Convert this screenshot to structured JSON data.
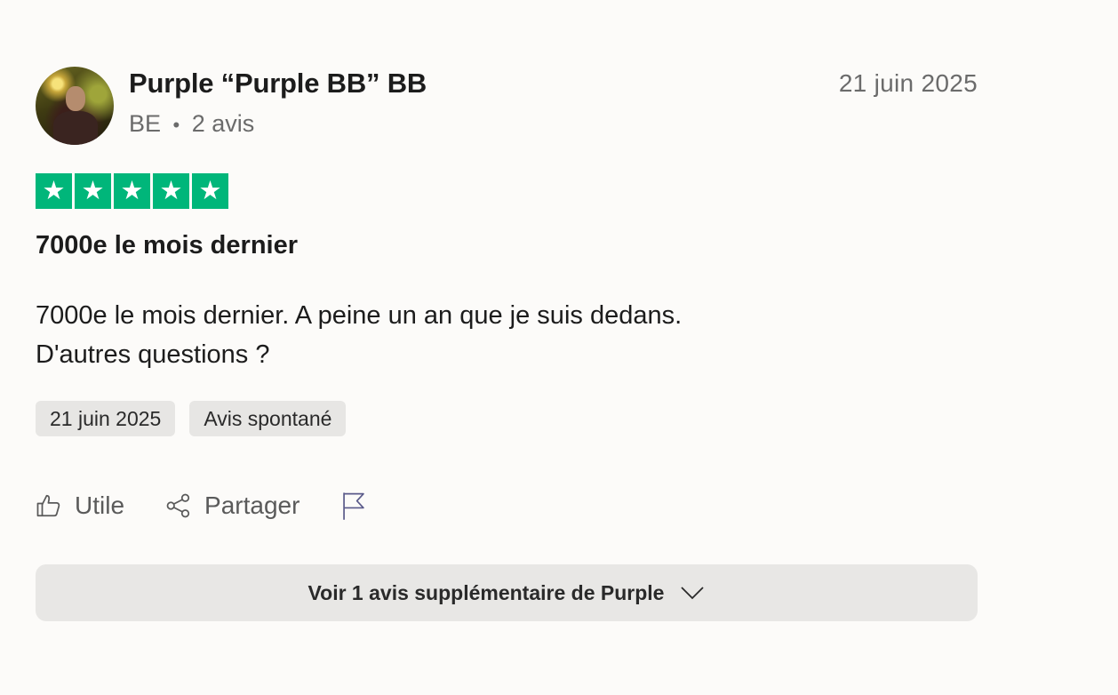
{
  "reviewer": {
    "name": "Purple “Purple BB” BB",
    "country": "BE",
    "separator": "•",
    "review_count": "2 avis"
  },
  "review": {
    "date": "21 juin 2025",
    "rating": 5,
    "title": "7000e le mois dernier",
    "body_line1": "7000e le mois dernier. A peine un an que je suis dedans.",
    "body_line2": "D'autres questions ?",
    "tags": [
      "21 juin 2025",
      "Avis spontané"
    ]
  },
  "actions": {
    "useful": "Utile",
    "share": "Partager"
  },
  "more_button": "Voir 1 avis supplémentaire de Purple",
  "icons": {
    "star": "★",
    "thumbs_up": "thumbs-up-icon",
    "share": "share-icon",
    "flag": "flag-icon",
    "chevron": "chevron-down-icon"
  },
  "colors": {
    "star_green": "#00b67a",
    "background": "#fcfbf9"
  }
}
